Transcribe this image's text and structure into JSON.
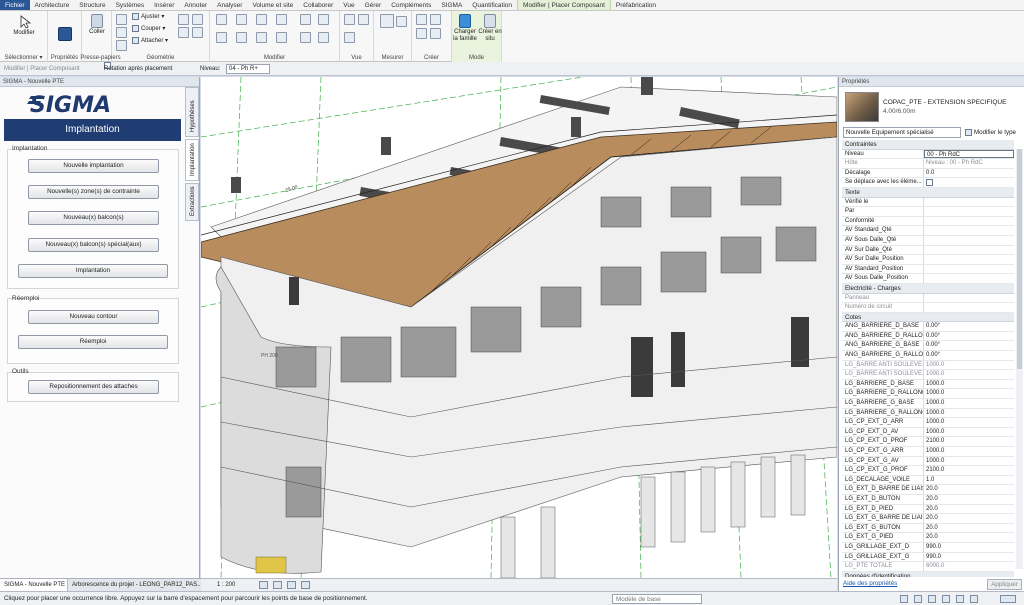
{
  "tabs": [
    "Fichier",
    "Architecture",
    "Structure",
    "Systèmes",
    "Insérer",
    "Annoter",
    "Analyser",
    "Volume et site",
    "Collaborer",
    "Vue",
    "Gérer",
    "Compléments",
    "SIGMA",
    "Quantification",
    "Modifier | Placer Composant",
    "Préfabrication"
  ],
  "ribbon": {
    "modify_label": "Modifier",
    "select_label": "Sélectionner ▾",
    "properties_label": "Propriétés",
    "paste_label": "Coller",
    "clipboard_label": "Presse-papiers",
    "adjust_label": "Ajuster ▾",
    "cut_label": "Couper ▾",
    "attach_label": "Attacher ▾",
    "geometry_label": "Géométrie",
    "modify_group_label": "Modifier",
    "view_label": "Vue",
    "measure_label": "Mesurer",
    "create_label": "Créer",
    "load_family_label": "Charger la famille",
    "create_inplace_label": "Créer en situ",
    "mode_label": "Mode"
  },
  "optbar": {
    "context": "Modifier | Placer Composant",
    "rotate_label": "Rotation après placement",
    "level_label": "Niveau:",
    "level_value": "04 - Ph R+"
  },
  "leftpanel": {
    "title": "SIGMA - Nouvelle PTE",
    "logo": "SIGMA",
    "banner": "Implantation",
    "vtabs": [
      "Hypothèses",
      "Implantation",
      "Extractions"
    ],
    "sect1": "Implantation",
    "btn_new_impl": "Nouvelle implantation",
    "btn_zones": "Nouvelle(s) zone(s) de contrainte",
    "btn_balcon": "Nouveau(x) balcon(s)",
    "btn_balcon_sp": "Nouveau(x) balcon(s) spécial(aux)",
    "btn_impl": "Implantation",
    "sect2": "Réemploi",
    "btn_contour": "Nouveau contour",
    "btn_reemploi": "Réemploi",
    "sect3": "Outils",
    "btn_attaches": "Repositionnement des attaches"
  },
  "bottom_tabs": [
    "SIGMA - Nouvelle PTE",
    "Arborescence du projet - LEONG_PAR12_PAS..."
  ],
  "view_ctrl": {
    "scale": "1 : 200"
  },
  "viewport": {
    "tag": "PH 200",
    "tag2": "25.00"
  },
  "properties": {
    "title": "Propriétés",
    "type_name": "COPAC_PTE - EXTENSION SPECIFIQUE",
    "type_size": "4.00/6.00m",
    "selector": "Nouvelle Equipement spécialisé",
    "edit_type": "Modifier le type",
    "groups": [
      {
        "name": "Contraintes",
        "rows": [
          {
            "k": "Niveau",
            "v": "00 - Ph RdC"
          },
          {
            "k": "Hôte",
            "v": "Niveau : 00 - Ph RdC"
          },
          {
            "k": "Décalage",
            "v": "0.0"
          },
          {
            "k": "Se déplace avec les éléme...",
            "v": ""
          }
        ]
      },
      {
        "name": "Texte",
        "rows": [
          {
            "k": "Vérifié le",
            "v": ""
          },
          {
            "k": "Par",
            "v": ""
          },
          {
            "k": "Conformité",
            "v": ""
          },
          {
            "k": "AV Standard_Qté",
            "v": ""
          },
          {
            "k": "AV Sous Dalle_Qté",
            "v": ""
          },
          {
            "k": "AV Sur Dalle_Qté",
            "v": ""
          },
          {
            "k": "AV Sur Dalle_Position",
            "v": ""
          },
          {
            "k": "AV Standard_Position",
            "v": ""
          },
          {
            "k": "AV Sous Dalle_Position",
            "v": ""
          }
        ]
      },
      {
        "name": "Electricité - Charges",
        "rows": [
          {
            "k": "Panneau",
            "v": ""
          },
          {
            "k": "Numéro de circuit",
            "v": ""
          }
        ]
      },
      {
        "name": "Cotes",
        "rows": [
          {
            "k": "ANG_BARRIERE_D_BASE",
            "v": "0.00°"
          },
          {
            "k": "ANG_BARRIERE_D_RALLO...",
            "v": "0.00°"
          },
          {
            "k": "ANG_BARRIERE_G_BASE",
            "v": "0.00°"
          },
          {
            "k": "ANG_BARRIERE_G_RALLO...",
            "v": "0.00°"
          },
          {
            "k": "LG_BARRE ANTI SOULEVE...",
            "v": "1000.0"
          },
          {
            "k": "LG_BARRE ANTI SOULEVE...",
            "v": "1000.0"
          },
          {
            "k": "LG_BARRIERE_D_BASE",
            "v": "1000.0"
          },
          {
            "k": "LG_BARRIERE_D_RALLONGE",
            "v": "1000.0"
          },
          {
            "k": "LG_BARRIERE_G_BASE",
            "v": "1000.0"
          },
          {
            "k": "LG_BARRIERE_G_RALLONGE",
            "v": "1000.0"
          },
          {
            "k": "LG_CP_EXT_D_ARR",
            "v": "1000.0"
          },
          {
            "k": "LG_CP_EXT_D_AV",
            "v": "1000.0"
          },
          {
            "k": "LG_CP_EXT_D_PROF",
            "v": "2100.0"
          },
          {
            "k": "LG_CP_EXT_G_ARR",
            "v": "1000.0"
          },
          {
            "k": "LG_CP_EXT_G_AV",
            "v": "1000.0"
          },
          {
            "k": "LG_CP_EXT_G_PROF",
            "v": "2100.0"
          },
          {
            "k": "LG_DECALAGE_VOILE",
            "v": "1.0"
          },
          {
            "k": "LG_EXT_D_BARRE DE LIAIS...",
            "v": "20.0"
          },
          {
            "k": "LG_EXT_D_BUTON",
            "v": "20.0"
          },
          {
            "k": "LG_EXT_D_PIED",
            "v": "20.0"
          },
          {
            "k": "LG_EXT_G_BARRE DE LIAIS...",
            "v": "20.0"
          },
          {
            "k": "LG_EXT_G_BUTON",
            "v": "20.0"
          },
          {
            "k": "LG_EXT_G_PIED",
            "v": "20.0"
          },
          {
            "k": "LG_GRILLAGE_EXT_D",
            "v": "990.0"
          },
          {
            "k": "LG_GRILLAGE_EXT_G",
            "v": "990.0"
          },
          {
            "k": "LG_PTE TOTALE",
            "v": "6000.0"
          }
        ]
      },
      {
        "name": "Données d'identification",
        "rows": []
      }
    ],
    "help_link": "Aide des propriétés",
    "apply": "Appliquer"
  },
  "status": {
    "message": "Cliquez pour placer une occurrence libre. Appuyez sur la barre d'espacement pour parcourir les points de base de positionnement.",
    "model": "Modèle de base"
  },
  "colors": {
    "accent": "#2b5797",
    "sigma_blue": "#1f3d72",
    "context_tab": "#e4f0d7"
  }
}
